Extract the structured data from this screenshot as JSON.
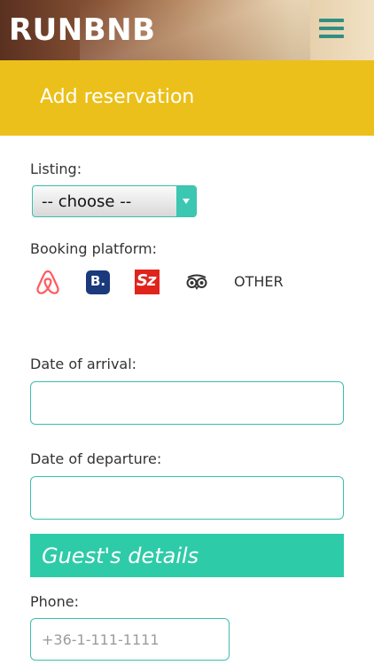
{
  "header": {
    "logo": "RUNBNB",
    "menu_icon": "hamburger-menu-icon",
    "menu_color": "#2f8f83"
  },
  "title_bar": {
    "title": "Add reservation",
    "color": "#ecc01a"
  },
  "form": {
    "listing": {
      "label": "Listing:",
      "selected": "-- choose --"
    },
    "booking_platform": {
      "label": "Booking platform:",
      "options": [
        {
          "icon": "airbnb-icon",
          "color": "#ff5a5f"
        },
        {
          "icon": "booking-com-icon",
          "text": "B.",
          "color": "#1a3a7c"
        },
        {
          "icon": "szallas-icon",
          "text": "Sz",
          "color": "#e0241c"
        },
        {
          "icon": "tripadvisor-icon",
          "color": "#333333"
        },
        {
          "label": "OTHER"
        }
      ]
    },
    "arrival": {
      "label": "Date of arrival:",
      "value": ""
    },
    "departure": {
      "label": "Date of departure:",
      "value": ""
    },
    "guest_section": {
      "title": "Guest's details",
      "color": "#2ecba9"
    },
    "phone": {
      "label": "Phone:",
      "placeholder": "+36-1-111-1111",
      "value": ""
    }
  },
  "accent_color": "#3bbfad"
}
